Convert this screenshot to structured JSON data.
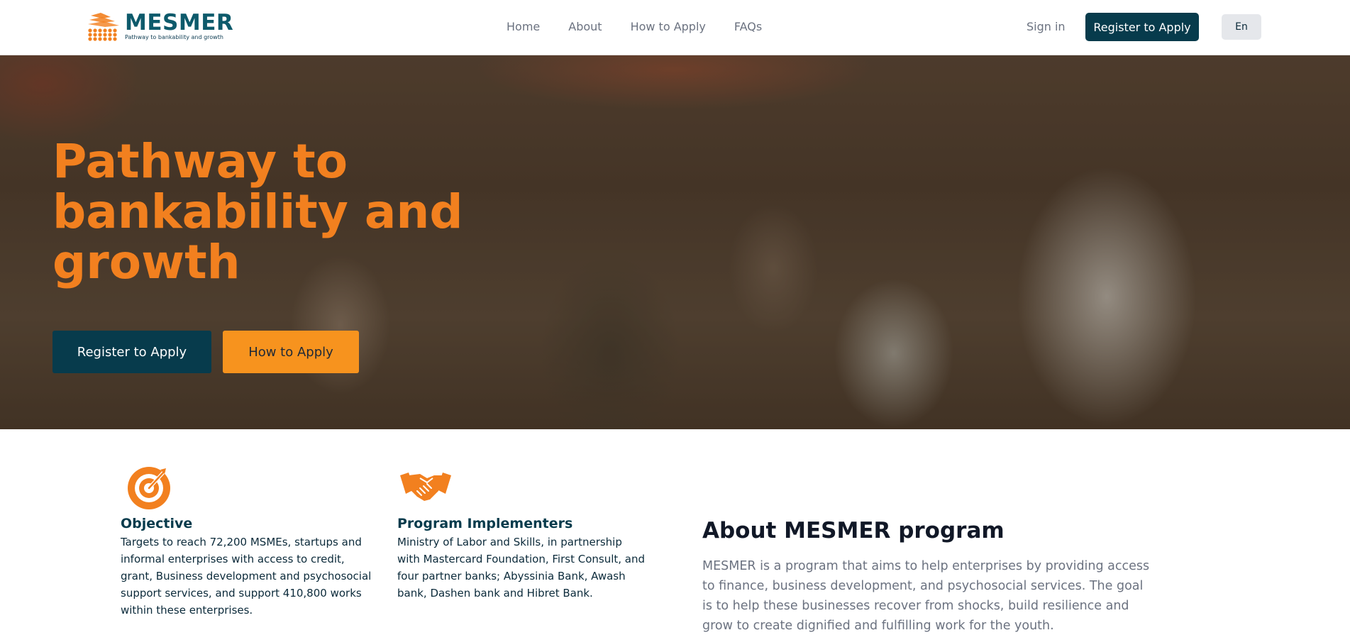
{
  "brand": {
    "name": "MESMER",
    "tagline": "Pathway to bankability and growth",
    "primary_color": "#073b4c",
    "accent_color": "#f2801f"
  },
  "nav": {
    "items": [
      "Home",
      "About",
      "How to Apply",
      "FAQs"
    ]
  },
  "header": {
    "sign_in": "Sign in",
    "register": "Register to Apply",
    "language": "En"
  },
  "hero": {
    "title": "Pathway to bankability and growth",
    "register_button": "Register to Apply",
    "how_button": "How to Apply"
  },
  "features": {
    "objective": {
      "icon": "target-icon",
      "title": "Objective",
      "text": "Targets to reach 72,200 MSMEs, startups and informal enterprises with access to credit, grant, Business development and psychosocial support services, and support 410,800 works within these enterprises."
    },
    "implementers": {
      "icon": "handshake-icon",
      "title": "Program Implementers",
      "text": "Ministry of Labor and Skills, in partnership with Mastercard Foundation, First Consult, and four partner banks; Abyssinia Bank, Awash bank, Dashen bank and Hibret Bank."
    }
  },
  "about": {
    "title": "About MESMER program",
    "text": "MESMER is a program that aims to help enterprises by providing access to finance, business development, and psychosocial services. The goal is to help these businesses recover from shocks, build resilience and grow to create dignified and fulfilling work for the youth."
  }
}
